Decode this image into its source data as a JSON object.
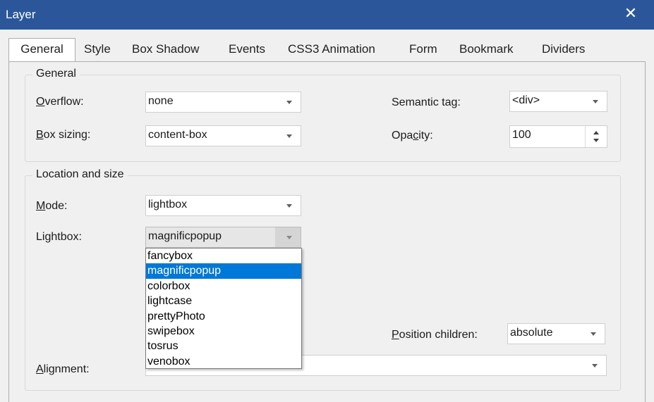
{
  "window": {
    "title": "Layer",
    "close_glyph": "✕"
  },
  "tabs": [
    {
      "label": "General",
      "active": true
    },
    {
      "label": "Style"
    },
    {
      "label": "Box Shadow"
    },
    {
      "label": "Events"
    },
    {
      "label": "CSS3 Animation"
    },
    {
      "label": "Form"
    },
    {
      "label": "Bookmark"
    },
    {
      "label": "Dividers"
    }
  ],
  "general": {
    "title": "General",
    "overflow": {
      "label_key": "O",
      "label_rest": "verflow:",
      "value": "none"
    },
    "box_sizing": {
      "label_key": "B",
      "label_rest": "ox sizing:",
      "value": "content-box"
    },
    "semantic_tag": {
      "label": "Semantic tag:",
      "value": "<div>"
    },
    "opacity": {
      "label_pre": "Opa",
      "label_key": "c",
      "label_rest": "ity:",
      "value": "100"
    }
  },
  "location": {
    "title": "Location and size",
    "mode": {
      "label_key": "M",
      "label_rest": "ode:",
      "value": "lightbox"
    },
    "lightbox": {
      "label": "Lightbox:",
      "value": "magnificpopup",
      "options": [
        "fancybox",
        "magnificpopup",
        "colorbox",
        "lightcase",
        "prettyPhoto",
        "swipebox",
        "tosrus",
        "venobox"
      ],
      "selected_index": 1
    },
    "position_children": {
      "label_key": "P",
      "label_rest": "osition children:",
      "value": "absolute"
    },
    "alignment": {
      "label_key": "A",
      "label_rest": "lignment:",
      "value": ""
    }
  },
  "colors": {
    "titlebar": "#2b579a",
    "selection": "#0078d7",
    "panel": "#f0f0f0"
  }
}
